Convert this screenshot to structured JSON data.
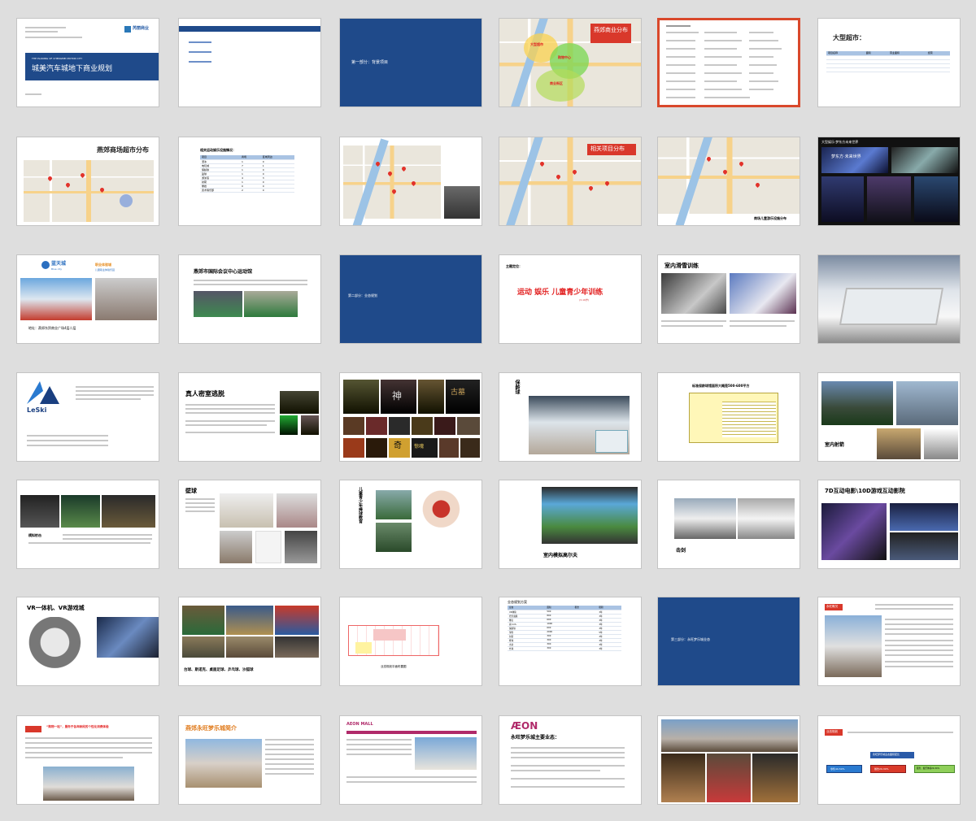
{
  "sorter": {
    "selected_slide": 5,
    "colors": {
      "brand_blue": "#1f4a8a",
      "selection": "#d9482b",
      "accent_red": "#e21f1f",
      "background": "#dedede"
    }
  },
  "slides": {
    "s1": {
      "brand": "芮丽商业",
      "title_en": "THE PLANING OF CHENGMEI MOTOR CITY",
      "title": "城美汽车城地下商业规划"
    },
    "s3": {
      "title": "第一部分：背景项目"
    },
    "s4": {
      "title": "燕郊商业分布",
      "zone_a": "大型超市",
      "zone_b": "购物中心",
      "zone_c": "商业街区"
    },
    "s6": {
      "title": "大型超市：",
      "headers": [
        "项目名称",
        "面积",
        "营业面积",
        "经营"
      ]
    },
    "s7": {
      "title": "燕郊商场超市分布"
    },
    "s8": {
      "title": "相关运动娱乐设施情况：",
      "headers": [
        "项目",
        "商场",
        "区域周边"
      ],
      "rows": [
        [
          "溜冰",
          "1",
          "0"
        ],
        [
          "电玩城",
          "7",
          "1"
        ],
        [
          "保龄球",
          "1",
          "0"
        ],
        [
          "篮球",
          "1",
          "0"
        ],
        [
          "游泳馆",
          "4",
          "3"
        ],
        [
          "射箭",
          "1",
          "0"
        ],
        [
          "攀岩",
          "0",
          "0"
        ],
        [
          "武术俱乐部",
          "2",
          "0"
        ]
      ]
    },
    "s10": {
      "title": "相关项目分布"
    },
    "s11": {
      "caption": "商场儿童游乐设施分布"
    },
    "s12": {
      "title": "大型娱乐·梦东方未来世界",
      "banner": "梦东方·未来世界"
    },
    "s13": {
      "logo": "蓝天城",
      "logo_sub": "Blue city",
      "tagline": "职业体验城",
      "tagline_sub": "儿童职业体验乐园",
      "caption": "地址：燕郊东贸商业广场4层二层"
    },
    "s14": {
      "title": "燕郊市国际会议中心运动馆"
    },
    "s15": {
      "title": "第二部分：业态规划"
    },
    "s16": {
      "label": "主题定位：",
      "headline": "运动 娱乐 儿童青少年训练",
      "sub": "(3-16岁)"
    },
    "s17": {
      "title": "室内滑雪训练"
    },
    "s19": {
      "logo": "LeSki"
    },
    "s20": {
      "title": "真人密室逃脱"
    },
    "s21": {
      "word1": "神",
      "word2": "古墓",
      "word3": "奇",
      "word4": "惊魂"
    },
    "s22": {
      "title": "保龄球"
    },
    "s23": {
      "title": "标准保龄球馆面积大概是500-600平方"
    },
    "s24": {
      "caption": "室内射箭"
    },
    "s25": {
      "caption": "模拟射击"
    },
    "s26": {
      "title": "壁球"
    },
    "s27": {
      "title": "儿童青少年棒球教育"
    },
    "s28": {
      "caption": "室内模拟高尔夫"
    },
    "s29": {
      "caption": "击剑"
    },
    "s30": {
      "title": "7D互动电影\\10D游戏互动影院"
    },
    "s31": {
      "title": "VR一体机、VR游戏城"
    },
    "s32": {
      "caption": "台球、斯诺克、桌面足球、乒乓球、沙狐球"
    },
    "s33": {
      "caption": "业态规划平面布置图"
    },
    "s34": {
      "title": "业态规划方案",
      "headers": [
        "业态",
        "面积",
        "租金",
        "租期"
      ],
      "rows": [
        [
          "VR体验",
          "500",
          "",
          "3年"
        ],
        [
          "密室逃脱",
          "800",
          "",
          "3年"
        ],
        [
          "攀岩",
          "600",
          "",
          "3年"
        ],
        [
          "真人CS",
          "1000",
          "",
          "3年"
        ],
        [
          "保龄球",
          "600",
          "",
          "3年"
        ],
        [
          "滑雪",
          "2000",
          "",
          "5年"
        ],
        [
          "射箭",
          "300",
          "",
          "3年"
        ],
        [
          "壁球",
          "300",
          "",
          "3年"
        ],
        [
          "击剑",
          "300",
          "",
          "3年"
        ],
        [
          "台球",
          "300",
          "",
          "3年"
        ]
      ]
    },
    "s35": {
      "title": "第三部分：永旺梦乐城业态"
    },
    "s36": {
      "label": "永旺概况"
    },
    "s37": {
      "headline": "“购物一站”，服务于各年龄段的个性化消费体验"
    },
    "s38": {
      "title": "燕郊永旺梦乐城简介"
    },
    "s39": {
      "logo": "AEON MALL"
    },
    "s40": {
      "logo": "ÆON",
      "title": "永旺梦乐城主要业态："
    },
    "s42": {
      "label": "业态规划",
      "box_top": "永旺梦乐城业态面积配比",
      "box1": "零售40-50%",
      "box2": "餐饮20-30%",
      "box3": "服务、娱乐体验20-30%"
    }
  }
}
